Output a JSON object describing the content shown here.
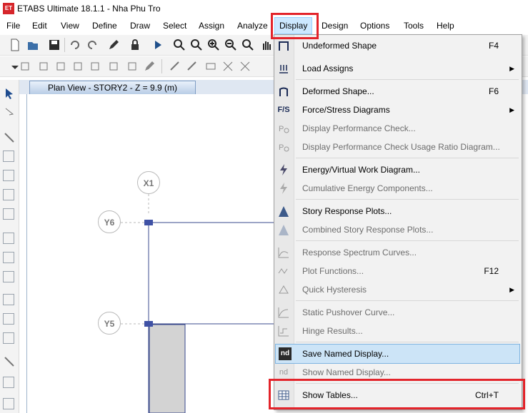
{
  "window": {
    "title": "ETABS Ultimate 18.1.1 - Nha Phu Tro",
    "logo_text": "ET"
  },
  "menubar": {
    "items": [
      "File",
      "Edit",
      "View",
      "Define",
      "Draw",
      "Select",
      "Assign",
      "Analyze",
      "Display",
      "Design",
      "Options",
      "Tools",
      "Help"
    ],
    "active": "Display"
  },
  "view": {
    "tab_title": "Plan View - STORY2 - Z = 9.9 (m)",
    "grid_labels": {
      "x1": "X1",
      "y6": "Y6",
      "y5": "Y5"
    }
  },
  "display_menu": {
    "items": [
      {
        "label": "Undeformed Shape",
        "shortcut": "F4",
        "submenu": false,
        "enabled": true,
        "icon": "undeformed-shape-icon"
      },
      {
        "label": "Load Assigns",
        "shortcut": "",
        "submenu": true,
        "enabled": true,
        "icon": "load-assigns-icon"
      },
      {
        "label": "Deformed Shape...",
        "shortcut": "F6",
        "submenu": false,
        "enabled": true,
        "icon": "deformed-shape-icon"
      },
      {
        "label": "Force/Stress Diagrams",
        "shortcut": "",
        "submenu": true,
        "enabled": true,
        "icon": "force-stress-icon",
        "icon_text": "F/S"
      },
      {
        "label": "Display Performance Check...",
        "shortcut": "",
        "submenu": false,
        "enabled": false,
        "icon": "performance-check-icon"
      },
      {
        "label": "Display Performance Check Usage Ratio Diagram...",
        "shortcut": "",
        "submenu": false,
        "enabled": false,
        "icon": "usage-ratio-icon"
      },
      {
        "label": "Energy/Virtual Work Diagram...",
        "shortcut": "",
        "submenu": false,
        "enabled": true,
        "icon": "energy-icon"
      },
      {
        "label": "Cumulative Energy Components...",
        "shortcut": "",
        "submenu": false,
        "enabled": false,
        "icon": "cumulative-energy-icon"
      },
      {
        "label": "Story Response Plots...",
        "shortcut": "",
        "submenu": false,
        "enabled": true,
        "icon": "story-response-icon"
      },
      {
        "label": "Combined Story Response Plots...",
        "shortcut": "",
        "submenu": false,
        "enabled": false,
        "icon": "combined-story-response-icon"
      },
      {
        "label": "Response Spectrum Curves...",
        "shortcut": "",
        "submenu": false,
        "enabled": false,
        "icon": "response-spectrum-icon"
      },
      {
        "label": "Plot Functions...",
        "shortcut": "F12",
        "submenu": false,
        "enabled": false,
        "icon": "plot-functions-icon"
      },
      {
        "label": "Quick Hysteresis",
        "shortcut": "",
        "submenu": true,
        "enabled": false,
        "icon": "hysteresis-icon"
      },
      {
        "label": "Static Pushover Curve...",
        "shortcut": "",
        "submenu": false,
        "enabled": false,
        "icon": "pushover-curve-icon"
      },
      {
        "label": "Hinge Results...",
        "shortcut": "",
        "submenu": false,
        "enabled": false,
        "icon": "hinge-results-icon"
      },
      {
        "label": "Save Named Display...",
        "shortcut": "",
        "submenu": false,
        "enabled": true,
        "icon": "save-named-display-icon",
        "icon_text": "nd",
        "highlighted": true
      },
      {
        "label": "Show Named Display...",
        "shortcut": "",
        "submenu": false,
        "enabled": false,
        "icon": "show-named-display-icon",
        "icon_text": "nd"
      },
      {
        "label": "Show Tables...",
        "shortcut": "Ctrl+T",
        "submenu": false,
        "enabled": true,
        "icon": "show-tables-icon"
      }
    ]
  },
  "colors": {
    "highlight_box": "#e3242b",
    "menu_hover": "#cce4f7",
    "grid_line": "#3a4a8c"
  }
}
